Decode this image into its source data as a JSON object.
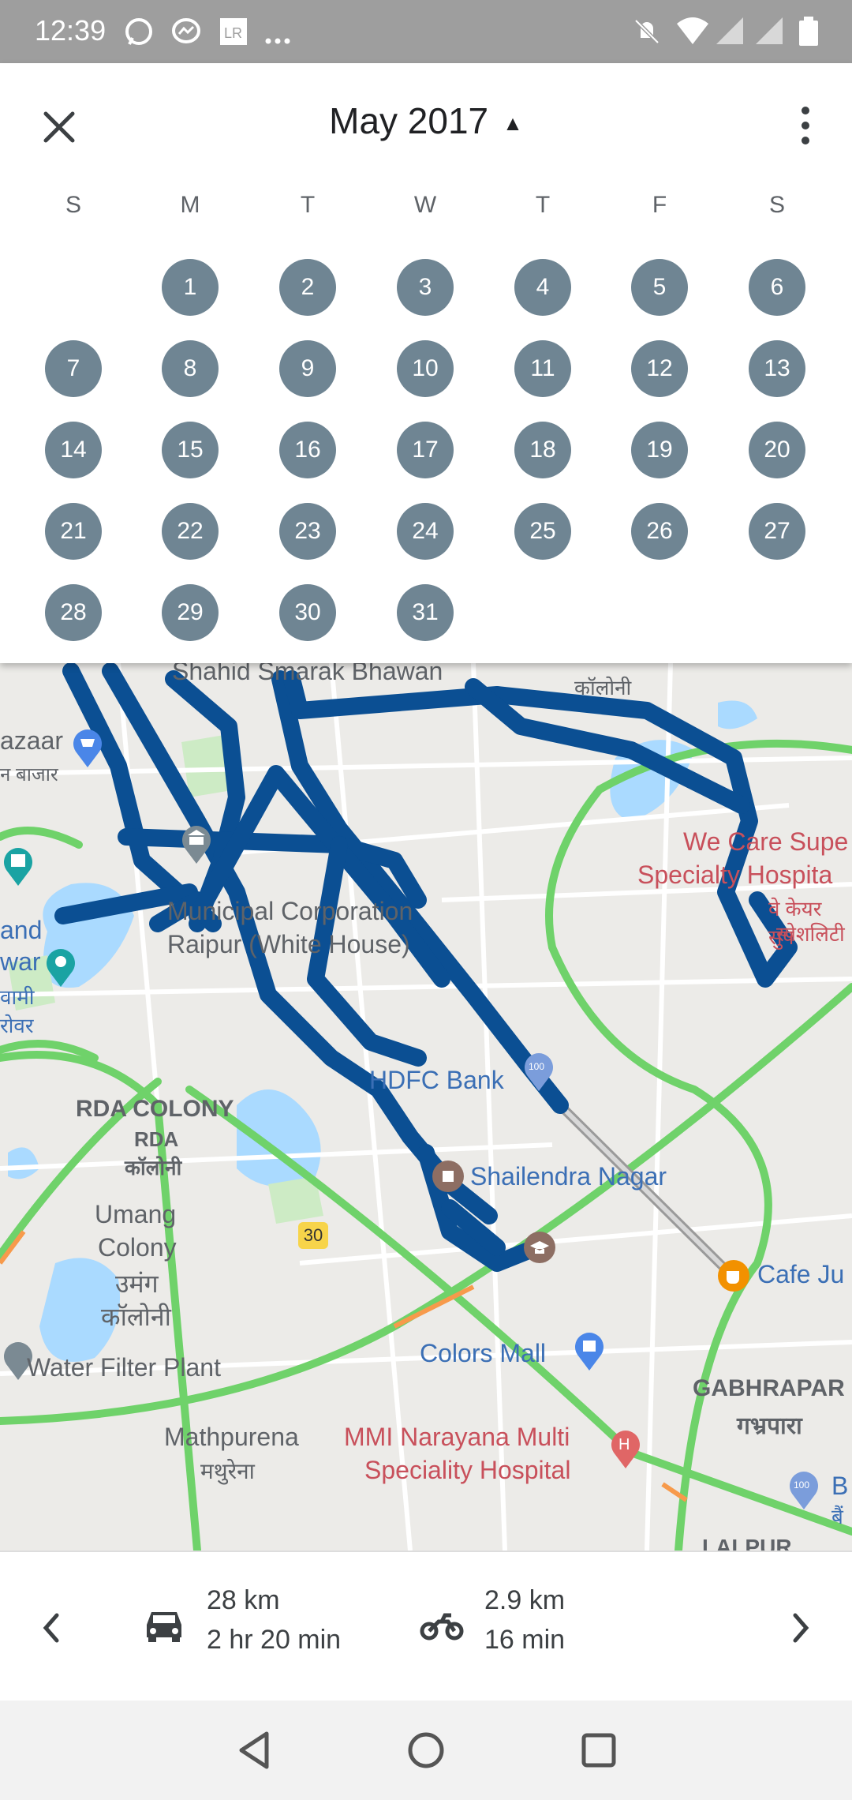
{
  "status_bar": {
    "time": "12:39"
  },
  "header": {
    "title": "May 2017"
  },
  "calendar": {
    "weekdays": [
      "S",
      "M",
      "T",
      "W",
      "T",
      "F",
      "S"
    ],
    "days": [
      "1",
      "2",
      "3",
      "4",
      "5",
      "6",
      "7",
      "8",
      "9",
      "10",
      "11",
      "12",
      "13",
      "14",
      "15",
      "16",
      "17",
      "18",
      "19",
      "20",
      "21",
      "22",
      "23",
      "24",
      "25",
      "26",
      "27",
      "28",
      "29",
      "30",
      "31"
    ],
    "day_color": "#6f8593"
  },
  "map": {
    "labels": {
      "shahid": "Shahid Smarak Bhawan",
      "colony_top": "कॉलोनी",
      "bazaar": "azaar",
      "bazaar_hi": "न बाजार",
      "we_care_1": "We Care Supe",
      "we_care_2": "Specialty Hospita",
      "we_care_hi_1": "वे केयर सुप",
      "we_care_hi_2": "स्पेशलिटी",
      "municipal_1": "Municipal Corporation",
      "municipal_2": "Raipur (White House)",
      "and": "and",
      "war": "war",
      "vami": "वामी",
      "rovar": "रोवर",
      "hdfc": "HDFC Bank",
      "rda_1": "RDA COLONY",
      "rda_2": "RDA",
      "rda_3": "कॉलोनी",
      "shailendra": "Shailendra Nagar",
      "umang_1": "Umang",
      "umang_2": "Colony",
      "umang_3": "उमंग",
      "umang_4": "कॉलोनी",
      "road_30": "30",
      "cafe": "Cafe Ju",
      "colors_mall": "Colors Mall",
      "water_filter": "Water Filter Plant",
      "gabhrapara_1": "GABHRAPAR",
      "gabhrapara_2": "गभ्रपारा",
      "mathpurena_1": "Mathpurena",
      "mathpurena_2": "मथुरेना",
      "mmi_1": "MMI Narayana Multi",
      "mmi_2": "Speciality Hospital",
      "ba": "B",
      "ba_hi": "बैं",
      "lalpur": "LALPUR"
    }
  },
  "footer": {
    "car": {
      "distance": "28 km",
      "duration": "2 hr 20 min"
    },
    "bike": {
      "distance": "2.9 km",
      "duration": "16 min"
    }
  }
}
